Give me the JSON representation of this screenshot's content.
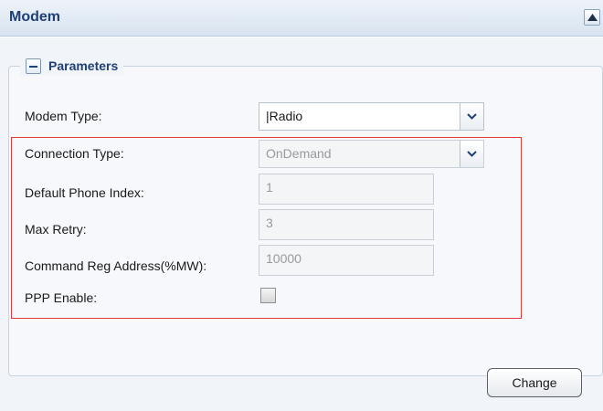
{
  "panel": {
    "title": "Modem",
    "collapse_icon": "triangle-up-icon"
  },
  "parameters": {
    "legend": "Parameters",
    "toggle_icon": "minus-icon"
  },
  "fields": {
    "modem_type": {
      "label": "Modem Type:",
      "value": "|Radio"
    },
    "connection_type": {
      "label": "Connection Type:",
      "value": "OnDemand"
    },
    "default_phone_index": {
      "label": "Default Phone Index:",
      "value": "1"
    },
    "max_retry": {
      "label": "Max Retry:",
      "value": "3"
    },
    "command_reg_address": {
      "label": "Command Reg Address(%MW):",
      "value": "10000"
    },
    "ppp_enable": {
      "label": "PPP Enable:",
      "checked": false
    }
  },
  "actions": {
    "change_label": "Change"
  },
  "colors": {
    "accent": "#1f3f77",
    "highlight_box": "#e03a3a"
  }
}
